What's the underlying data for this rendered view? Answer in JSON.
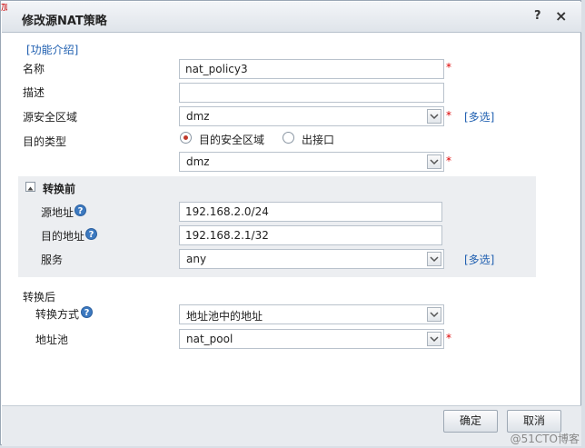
{
  "dialog": {
    "title": "修改源NAT策略",
    "help_button": "?",
    "close_button": "×",
    "left_edge_text": "加"
  },
  "intro_link": "[功能介绍]",
  "form": {
    "name_label": "名称",
    "name_value": "nat_policy3",
    "desc_label": "描述",
    "desc_value": "",
    "src_zone_label": "源安全区域",
    "src_zone_value": "dmz",
    "multi_select_link": "[多选]",
    "dest_type_label": "目的类型",
    "dest_type_options": [
      "目的安全区域",
      "出接口"
    ],
    "dest_type_selected": "目的安全区域",
    "dest_zone_value": "dmz",
    "required_mark": "*"
  },
  "before": {
    "title": "转换前",
    "src_addr_label": "源地址",
    "src_addr_value": "192.168.2.0/24",
    "dst_addr_label": "目的地址",
    "dst_addr_value": "192.168.2.1/32",
    "service_label": "服务",
    "service_value": "any",
    "multi_select_link": "[多选]"
  },
  "after": {
    "title": "转换后",
    "mode_label": "转换方式",
    "mode_value": "地址池中的地址",
    "pool_label": "地址池",
    "pool_value": "nat_pool"
  },
  "help_glyph": "?",
  "footer": {
    "ok": "确定",
    "cancel": "取消"
  },
  "watermark": "@51CTO博客"
}
